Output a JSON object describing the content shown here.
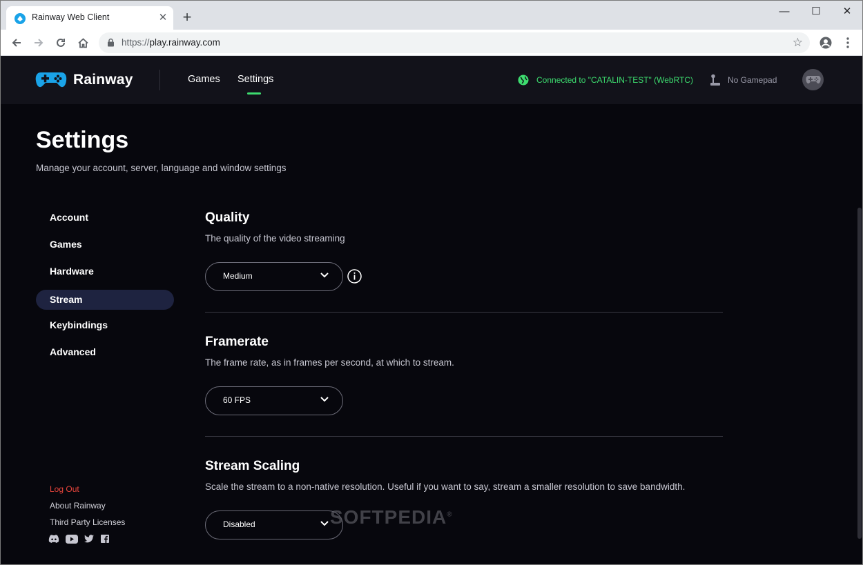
{
  "browser": {
    "tab_title": "Rainway Web Client",
    "new_tab": "+",
    "url_scheme": "https://",
    "url_host": "play.rainway.com",
    "minimize": "—",
    "maximize": "☐",
    "close": "✕",
    "tab_close": "✕"
  },
  "header": {
    "brand": "Rainway",
    "nav": [
      "Games",
      "Settings"
    ],
    "active_nav": "Settings",
    "connection": "Connected to \"CATALIN-TEST\" (WebRTC)",
    "gamepad": "No Gamepad",
    "accent": "#3ddc6f"
  },
  "page": {
    "title": "Settings",
    "subtitle": "Manage your account, server, language and window settings"
  },
  "sidebar": {
    "items": [
      "Account",
      "Games",
      "Hardware",
      "Stream",
      "Keybindings",
      "Advanced"
    ],
    "active": "Stream",
    "footer": {
      "logout": "Log Out",
      "about": "About Rainway",
      "licenses": "Third Party Licenses"
    },
    "social_icons": [
      "discord-icon",
      "youtube-icon",
      "twitter-icon",
      "facebook-icon"
    ]
  },
  "sections": {
    "quality": {
      "title": "Quality",
      "desc": "The quality of the video streaming",
      "value": "Medium"
    },
    "framerate": {
      "title": "Framerate",
      "desc": "The frame rate, as in frames per second, at which to stream.",
      "value": "60 FPS"
    },
    "scaling": {
      "title": "Stream Scaling",
      "desc": "Scale the stream to a non-native resolution. Useful if you want to say, stream a smaller resolution to save bandwidth.",
      "value": "Disabled"
    }
  },
  "watermark": "SOFTPEDIA",
  "watermark_mark": "®"
}
